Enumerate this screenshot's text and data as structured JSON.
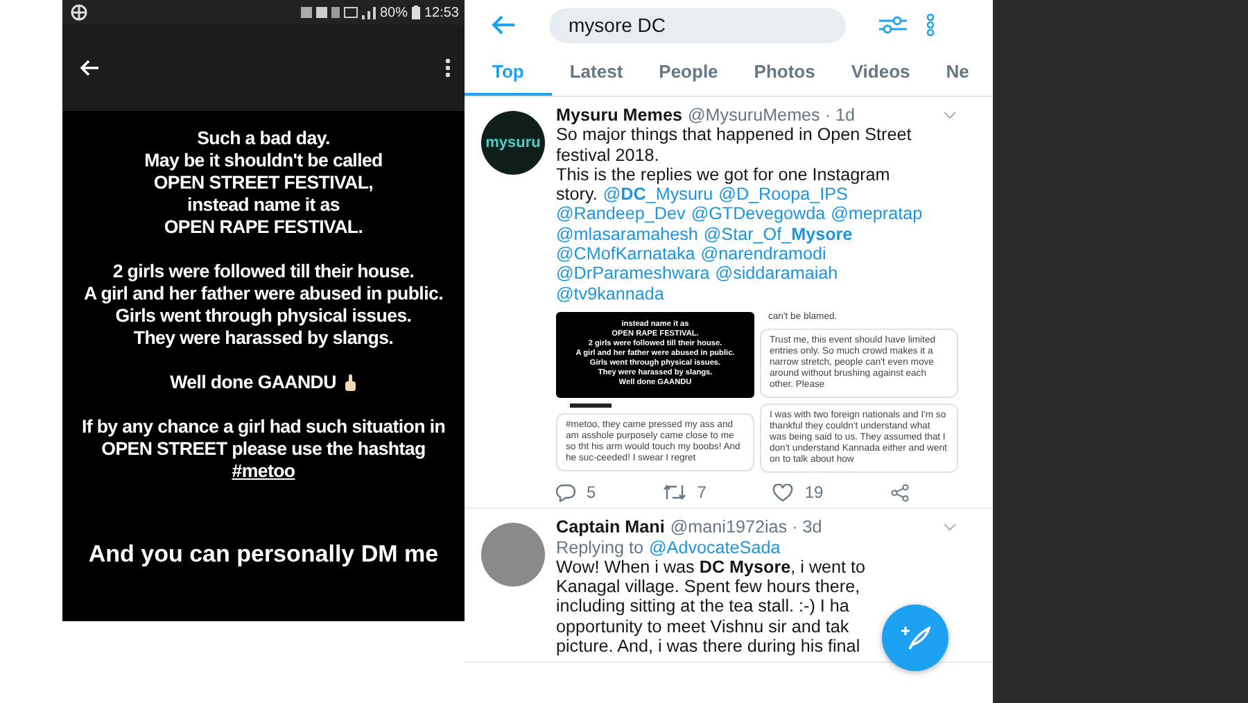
{
  "left_phone": {
    "status_bar": {
      "battery": "80%",
      "time": "12:53"
    },
    "story": [
      {
        "lines": [
          {
            "kind": "text",
            "text": "Such a bad day."
          },
          {
            "kind": "text",
            "text": "May be it shouldn't be called"
          },
          {
            "kind": "text",
            "text": "OPEN STREET FESTIVAL,"
          },
          {
            "kind": "text",
            "text": "instead name it as"
          },
          {
            "kind": "text",
            "text": "OPEN RAPE FESTIVAL."
          }
        ]
      },
      {
        "lines": [
          {
            "kind": "text",
            "text": "2 girls were followed till their house."
          },
          {
            "kind": "text",
            "text": "A girl and her father were abused in public."
          },
          {
            "kind": "text",
            "text": "Girls went through  physical issues."
          },
          {
            "kind": "text",
            "text": "They were harassed by slangs."
          }
        ]
      },
      {
        "lines": [
          {
            "kind": "hand",
            "text": "Well done GAANDU"
          }
        ]
      },
      {
        "lines": [
          {
            "kind": "text",
            "text": "If by any chance a girl had such situation in"
          },
          {
            "kind": "text",
            "text": "OPEN STREET  please use the hashtag"
          },
          {
            "kind": "hashtag",
            "text": "#metoo"
          }
        ]
      }
    ],
    "closing": "And you can personally DM me"
  },
  "right_phone": {
    "search": {
      "value": "mysore DC"
    },
    "tabs": [
      {
        "label": "Top",
        "selected": true
      },
      {
        "label": "Latest",
        "selected": false
      },
      {
        "label": "People",
        "selected": false
      },
      {
        "label": "Photos",
        "selected": false
      },
      {
        "label": "Videos",
        "selected": false
      },
      {
        "label": "Ne",
        "selected": false
      }
    ],
    "tweets": [
      {
        "name": "Mysuru Memes",
        "handle": "@MysuruMemes · 1d",
        "avatar": {
          "kind": "logo",
          "text": "mysuru"
        },
        "lines": [
          [
            {
              "kind": "text",
              "text": "So major things that happened in Open Street"
            }
          ],
          [
            {
              "kind": "text",
              "text": "festival 2018."
            }
          ],
          [
            {
              "kind": "text",
              "text": "This is the replies we got for one Instagram"
            }
          ],
          [
            {
              "kind": "text",
              "text": "story."
            },
            {
              "kind": "mention",
              "text": "@**DC**_Mysuru"
            },
            {
              "kind": "mention",
              "text": "@D_Roopa_IPS"
            }
          ],
          [
            {
              "kind": "mention",
              "text": "@Randeep_Dev"
            },
            {
              "kind": "mention",
              "text": "@GTDevegowda"
            },
            {
              "kind": "mention",
              "text": "@mepratap"
            }
          ],
          [
            {
              "kind": "mention",
              "text": "@mlasaramahesh"
            },
            {
              "kind": "mention",
              "text": "@Star_Of_**Mysore**"
            }
          ],
          [
            {
              "kind": "mention",
              "text": "@CMofKarnataka"
            },
            {
              "kind": "mention",
              "text": "@narendramodi"
            }
          ],
          [
            {
              "kind": "mention",
              "text": "@DrParameshwara"
            },
            {
              "kind": "mention",
              "text": "@siddaramaiah"
            }
          ],
          [
            {
              "kind": "mention",
              "text": "@tv9kannada"
            }
          ]
        ],
        "media": {
          "story_lines": [
            "instead name it as",
            "OPEN RAPE FESTIVAL.",
            "2 girls were followed till their house.",
            "A girl and her father were abused in public.",
            "Girls went through  physical issues.",
            "They were harassed by slangs.",
            "Well done GAANDU"
          ],
          "cards": [
            {
              "text": "#metoo, they came pressed my ass and am asshole purposely came close to me so tht his arm would touch my boobs! And he suc-ceeded! I swear I regret"
            },
            {
              "text": "can't be blamed."
            },
            {
              "text": "Trust me, this event should have limited entries only. So much crowd makes it a narrow stretch, people can't even move around without brushing against each other. Please"
            },
            {
              "text": "I was with two foreign nationals and I'm so thankful they couldn't understand what was being said to us. They assumed that I don't understand Kannada either and went on to talk about how"
            }
          ]
        },
        "actions": {
          "replies": "5",
          "retweets": "7",
          "likes": "19"
        }
      },
      {
        "name": "Captain Mani",
        "handle": "@mani1972ias · 3d",
        "avatar": {
          "kind": "photo"
        },
        "reply_to": {
          "label": "Replying to",
          "mention": "@AdvocateSada"
        },
        "lines": [
          [
            {
              "kind": "text",
              "text": "Wow! When i was **DC Mysore**, i went to"
            }
          ],
          [
            {
              "kind": "text",
              "text": "Kanagal village. Spent few hours there,"
            }
          ],
          [
            {
              "kind": "text",
              "text": "including sitting at the tea stall. :-) I ha"
            }
          ],
          [
            {
              "kind": "text",
              "text": "opportunity to meet Vishnu sir and tak"
            }
          ],
          [
            {
              "kind": "text",
              "text": "picture. And, i was there during his final"
            }
          ]
        ]
      }
    ]
  }
}
